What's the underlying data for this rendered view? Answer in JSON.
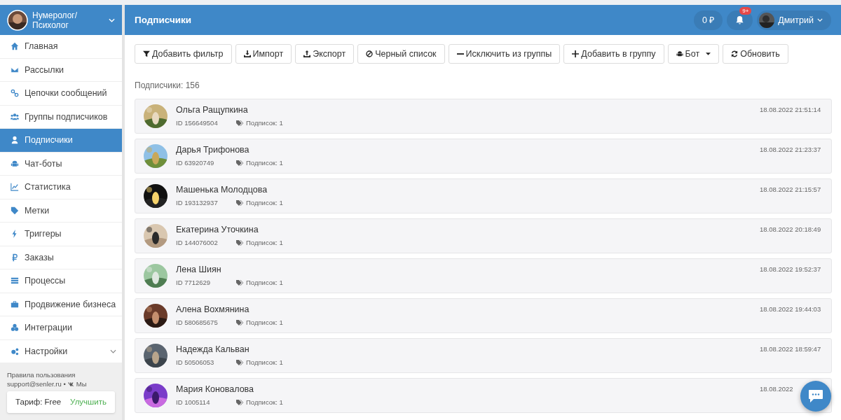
{
  "account": {
    "name": "Нумеролог/ Психолог"
  },
  "sidebar": {
    "items": [
      {
        "label": "Главная",
        "selected": false,
        "kind": "link"
      },
      {
        "label": "Рассылки",
        "selected": false,
        "kind": "link"
      },
      {
        "label": "Цепочки сообщений",
        "selected": false,
        "kind": "link"
      },
      {
        "label": "Группы подписчиков",
        "selected": false,
        "kind": "link"
      },
      {
        "label": "Подписчики",
        "selected": true,
        "kind": "link"
      },
      {
        "label": "Чат-боты",
        "selected": false,
        "kind": "link"
      },
      {
        "label": "Статистика",
        "selected": false,
        "kind": "link"
      },
      {
        "label": "Метки",
        "selected": false,
        "kind": "link"
      },
      {
        "label": "Триггеры",
        "selected": false,
        "kind": "link"
      },
      {
        "label": "Заказы",
        "selected": false,
        "kind": "link"
      },
      {
        "label": "Процессы",
        "selected": false,
        "kind": "link"
      },
      {
        "label": "Продвижение бизнеса",
        "selected": false,
        "kind": "link"
      },
      {
        "label": "Интеграции",
        "selected": false,
        "kind": "link"
      },
      {
        "label": "Настройки",
        "selected": false,
        "kind": "submenu"
      }
    ],
    "footer": {
      "terms": "Правила пользования",
      "support": "support@senler.ru •",
      "vk": "Мы"
    },
    "plan": {
      "label": "Тариф: Free",
      "upgrade": "Улучшить"
    }
  },
  "header": {
    "title": "Подписчики",
    "balance": "0 ₽",
    "notifications": "9+",
    "user": "Дмитрий"
  },
  "toolbar": [
    {
      "label": "Добавить фильтр",
      "kind": "filter"
    },
    {
      "label": "Импорт",
      "kind": "download"
    },
    {
      "label": "Экспорт",
      "kind": "upload"
    },
    {
      "label": "Черный список",
      "kind": "ban"
    },
    {
      "label": "Исключить из группы",
      "kind": "minus"
    },
    {
      "label": "Добавить в группу",
      "kind": "plus"
    },
    {
      "label": "Бот",
      "kind": "bot"
    },
    {
      "label": "Обновить",
      "kind": "refresh"
    }
  ],
  "count": "Подписчики: 156",
  "subscribers": [
    {
      "name": "Ольга Ращупкина",
      "id": "ID 156649504",
      "subs": "Подписок: 1",
      "date": "18.08.2022 21:51:14"
    },
    {
      "name": "Дарья Трифонова",
      "id": "ID 63920749",
      "subs": "Подписок: 1",
      "date": "18.08.2022 21:23:37"
    },
    {
      "name": "Машенька Молодцова",
      "id": "ID 193132937",
      "subs": "Подписок: 1",
      "date": "18.08.2022 21:15:57"
    },
    {
      "name": "Екатерина Уточкина",
      "id": "ID 144076002",
      "subs": "Подписок: 1",
      "date": "18.08.2022 20:18:49"
    },
    {
      "name": "Лена Шиян",
      "id": "ID 7712629",
      "subs": "Подписок: 1",
      "date": "18.08.2022 19:52:37"
    },
    {
      "name": "Алена Вохмянина",
      "id": "ID 580685675",
      "subs": "Подписок: 1",
      "date": "18.08.2022 19:44:03"
    },
    {
      "name": "Надежда Кальван",
      "id": "ID 50506053",
      "subs": "Подписок: 1",
      "date": "18.08.2022 18:59:47"
    },
    {
      "name": "Мария Коновалова",
      "id": "ID 1005114",
      "subs": "Подписок: 1",
      "date": "18.08.2022"
    }
  ]
}
